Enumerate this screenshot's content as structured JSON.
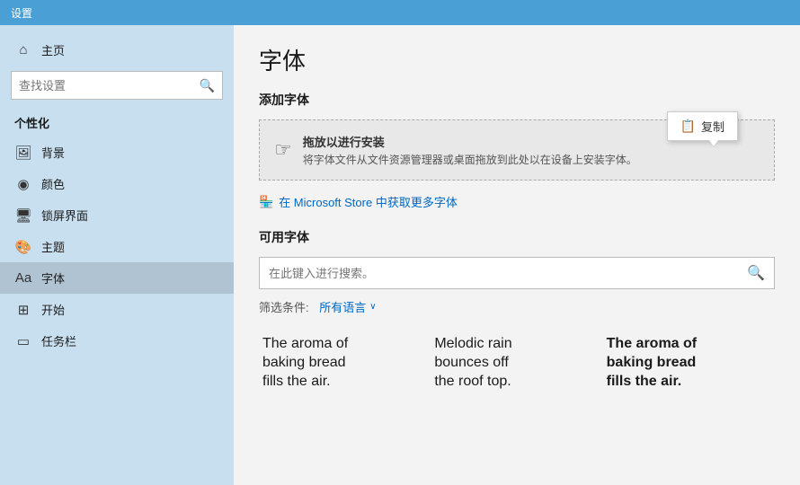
{
  "topbar": {
    "label": "设置"
  },
  "sidebar": {
    "search_placeholder": "查找设置",
    "section_label": "个性化",
    "items": [
      {
        "id": "home",
        "icon": "⌂",
        "label": "主页"
      },
      {
        "id": "background",
        "icon": "🖼",
        "label": "背景"
      },
      {
        "id": "color",
        "icon": "◉",
        "label": "颜色"
      },
      {
        "id": "lockscreen",
        "icon": "🖥",
        "label": "锁屏界面"
      },
      {
        "id": "theme",
        "icon": "🎨",
        "label": "主题"
      },
      {
        "id": "font",
        "icon": "Aa",
        "label": "字体",
        "active": true
      },
      {
        "id": "start",
        "icon": "⊞",
        "label": "开始"
      },
      {
        "id": "taskbar",
        "icon": "▭",
        "label": "任务栏"
      }
    ]
  },
  "main": {
    "page_title": "字体",
    "add_font_section": "添加字体",
    "drop_zone": {
      "main_text": "拖放以进行安装",
      "sub_text": "将字体文件从文件资源管理器或桌面拖放到此处以在设备上安装字体。"
    },
    "tooltip": {
      "icon": "📋",
      "label": "复制"
    },
    "store_link": "在 Microsoft Store 中获取更多字体",
    "available_fonts_section": "可用字体",
    "search_placeholder": "在此键入进行搜索。",
    "filter_label": "筛选条件:",
    "filter_value": "所有语言",
    "font_previews": [
      {
        "style": "normal",
        "lines": [
          "The aroma of",
          "baking bread",
          "fills the air."
        ]
      },
      {
        "style": "normal",
        "lines": [
          "Melodic rain",
          "bounces off",
          "the roof top."
        ]
      },
      {
        "style": "bold",
        "lines": [
          "The aroma of",
          "baking bread",
          "fills the air."
        ]
      }
    ]
  }
}
